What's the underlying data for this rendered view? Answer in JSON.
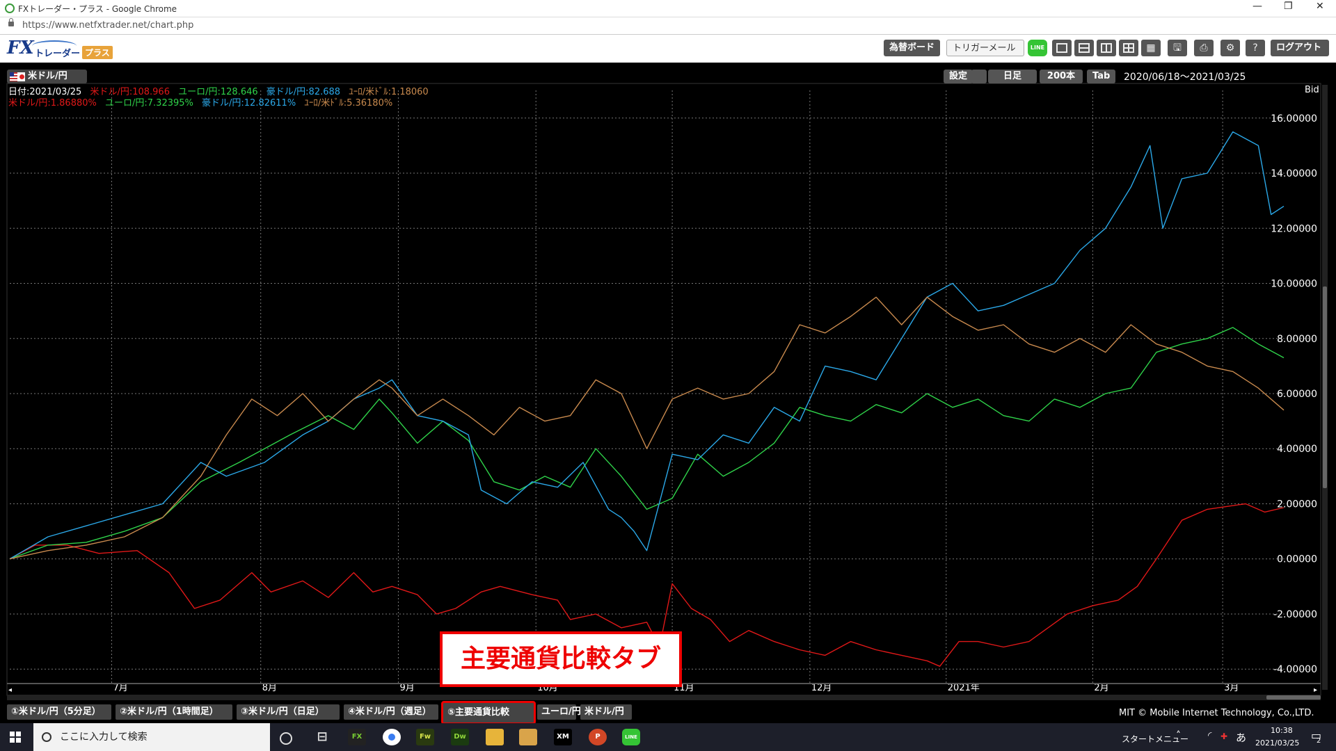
{
  "browser": {
    "title": "FXトレーダー・プラス - Google Chrome",
    "url": "https://www.netfxtrader.net/chart.php"
  },
  "app": {
    "logo_fx": "FX",
    "logo_trader": "トレーダー・",
    "logo_plus": "プラス",
    "buttons": {
      "rate_board": "為替ボード",
      "trigger_mail": "トリガーメール",
      "line": "LINE",
      "logout": "ログアウト"
    }
  },
  "chart_panel": {
    "pair_label": "米ドル/円",
    "settings": "設定",
    "timeframe": "日足",
    "bars": "200本",
    "tab_btn": "Tab",
    "range": "2020/06/18～2021/03/25",
    "price_type": "Bid"
  },
  "info_line1": {
    "date": "日付:2021/03/25",
    "usdjpy": "米ドル/円:108.966",
    "eurjpy": "ユーロ/円:128.646",
    "audjpy": "豪ドル/円:82.688",
    "eurusd": "ﾕｰﾛ/米ﾄﾞﾙ:1.18060"
  },
  "info_line2": {
    "usdjpy": "米ドル/円:1.86880%",
    "eurjpy": "ユーロ/円:7.32395%",
    "audjpy": "豪ドル/円:12.82611%",
    "eurusd": "ﾕｰﾛ/米ﾄﾞﾙ:5.36180%"
  },
  "colors": {
    "usdjpy": "#e01818",
    "eurjpy": "#2fd34a",
    "audjpy": "#2ba8e8",
    "eurusd": "#c98a4e"
  },
  "chart_data": {
    "type": "line",
    "ylim": [
      -4.5,
      16.5
    ],
    "y_ticks": [
      "16.00000",
      "14.00000",
      "12.00000",
      "10.00000",
      "8.00000",
      "6.00000",
      "4.00000",
      "2.00000",
      "0.00000",
      "-2.00000",
      "-4.00000"
    ],
    "x_labels": [
      "7月",
      "8月",
      "9月",
      "10月",
      "11月",
      "12月",
      "2021年",
      "2月",
      "3月"
    ],
    "x_label_positions": [
      0.08,
      0.197,
      0.305,
      0.413,
      0.52,
      0.628,
      0.735,
      0.85,
      0.952
    ],
    "x_range": [
      0,
      1
    ],
    "series": [
      {
        "name": "米ドル/円",
        "key": "usdjpy",
        "x": [
          0,
          0.02,
          0.045,
          0.07,
          0.1,
          0.125,
          0.145,
          0.165,
          0.19,
          0.205,
          0.23,
          0.25,
          0.27,
          0.285,
          0.3,
          0.32,
          0.335,
          0.35,
          0.37,
          0.385,
          0.41,
          0.43,
          0.44,
          0.46,
          0.48,
          0.5,
          0.51,
          0.52,
          0.535,
          0.55,
          0.565,
          0.58,
          0.6,
          0.62,
          0.64,
          0.66,
          0.68,
          0.7,
          0.72,
          0.73,
          0.745,
          0.76,
          0.78,
          0.8,
          0.83,
          0.85,
          0.87,
          0.885,
          0.9,
          0.92,
          0.94,
          0.955,
          0.97,
          0.985,
          1.0
        ],
        "y": [
          0,
          0.5,
          0.5,
          0.2,
          0.3,
          -0.5,
          -1.8,
          -1.5,
          -0.5,
          -1.2,
          -0.8,
          -1.4,
          -0.5,
          -1.2,
          -1.0,
          -1.3,
          -2.0,
          -1.8,
          -1.2,
          -1.0,
          -1.3,
          -1.5,
          -2.2,
          -2.0,
          -2.5,
          -2.3,
          -3.2,
          -0.9,
          -1.8,
          -2.2,
          -3.0,
          -2.6,
          -3.0,
          -3.3,
          -3.5,
          -3.0,
          -3.3,
          -3.5,
          -3.7,
          -3.9,
          -3.0,
          -3.0,
          -3.2,
          -3.0,
          -2.0,
          -1.7,
          -1.5,
          -1.0,
          0.0,
          1.4,
          1.8,
          1.9,
          2.0,
          1.7,
          1.86
        ]
      },
      {
        "name": "ユーロ/円",
        "key": "eurjpy",
        "x": [
          0,
          0.03,
          0.06,
          0.09,
          0.12,
          0.15,
          0.18,
          0.2,
          0.22,
          0.25,
          0.27,
          0.29,
          0.3,
          0.32,
          0.34,
          0.36,
          0.38,
          0.4,
          0.42,
          0.44,
          0.46,
          0.48,
          0.5,
          0.52,
          0.54,
          0.56,
          0.58,
          0.6,
          0.62,
          0.64,
          0.66,
          0.68,
          0.7,
          0.72,
          0.74,
          0.76,
          0.78,
          0.8,
          0.82,
          0.84,
          0.86,
          0.88,
          0.9,
          0.92,
          0.94,
          0.96,
          0.98,
          1.0
        ],
        "y": [
          0,
          0.5,
          0.6,
          1.0,
          1.5,
          2.8,
          3.5,
          4.0,
          4.5,
          5.2,
          4.7,
          5.8,
          5.3,
          4.2,
          5.0,
          4.3,
          2.8,
          2.5,
          3.0,
          2.6,
          4.0,
          3.0,
          1.8,
          2.2,
          3.8,
          3.0,
          3.5,
          4.2,
          5.5,
          5.2,
          5.0,
          5.6,
          5.3,
          6.0,
          5.5,
          5.8,
          5.2,
          5.0,
          5.8,
          5.5,
          6.0,
          6.2,
          7.5,
          7.8,
          8.0,
          8.4,
          7.8,
          7.3
        ]
      },
      {
        "name": "豪ドル/円",
        "key": "audjpy",
        "x": [
          0,
          0.03,
          0.06,
          0.09,
          0.12,
          0.15,
          0.17,
          0.2,
          0.23,
          0.25,
          0.27,
          0.29,
          0.3,
          0.32,
          0.34,
          0.36,
          0.37,
          0.39,
          0.41,
          0.43,
          0.45,
          0.47,
          0.48,
          0.49,
          0.5,
          0.52,
          0.54,
          0.56,
          0.58,
          0.6,
          0.62,
          0.64,
          0.66,
          0.68,
          0.7,
          0.72,
          0.74,
          0.76,
          0.78,
          0.8,
          0.82,
          0.84,
          0.86,
          0.88,
          0.895,
          0.905,
          0.92,
          0.94,
          0.96,
          0.98,
          0.99,
          1.0
        ],
        "y": [
          0,
          0.8,
          1.2,
          1.6,
          2.0,
          3.5,
          3.0,
          3.5,
          4.5,
          5.0,
          5.8,
          6.2,
          6.5,
          5.2,
          5.0,
          4.5,
          2.5,
          2.0,
          2.8,
          2.6,
          3.5,
          1.8,
          1.5,
          1.0,
          0.3,
          3.8,
          3.6,
          4.5,
          4.2,
          5.5,
          5.0,
          7.0,
          6.8,
          6.5,
          8.0,
          9.5,
          10.0,
          9.0,
          9.2,
          9.6,
          10.0,
          11.2,
          12.0,
          13.5,
          15.0,
          12.0,
          13.8,
          14.0,
          15.5,
          15.0,
          12.5,
          12.8
        ]
      },
      {
        "name": "ﾕｰﾛ/米ﾄﾞﾙ",
        "key": "eurusd",
        "x": [
          0,
          0.03,
          0.06,
          0.09,
          0.12,
          0.15,
          0.17,
          0.19,
          0.21,
          0.23,
          0.25,
          0.27,
          0.29,
          0.3,
          0.32,
          0.34,
          0.36,
          0.38,
          0.4,
          0.42,
          0.44,
          0.46,
          0.48,
          0.5,
          0.52,
          0.54,
          0.56,
          0.58,
          0.6,
          0.62,
          0.64,
          0.66,
          0.68,
          0.7,
          0.72,
          0.74,
          0.76,
          0.78,
          0.8,
          0.82,
          0.84,
          0.86,
          0.88,
          0.9,
          0.92,
          0.94,
          0.96,
          0.98,
          1.0
        ],
        "y": [
          0,
          0.3,
          0.5,
          0.8,
          1.5,
          3.0,
          4.5,
          5.8,
          5.2,
          6.0,
          5.0,
          5.8,
          6.5,
          6.2,
          5.2,
          5.8,
          5.2,
          4.5,
          5.5,
          5.0,
          5.2,
          6.5,
          6.0,
          4.0,
          5.8,
          6.2,
          5.8,
          6.0,
          6.8,
          8.5,
          8.2,
          8.8,
          9.5,
          8.5,
          9.5,
          8.8,
          8.3,
          8.5,
          7.8,
          7.5,
          8.0,
          7.5,
          8.5,
          7.8,
          7.5,
          7.0,
          6.8,
          6.2,
          5.4
        ]
      }
    ]
  },
  "bottom_tabs": [
    "①米ドル/円（5分足）",
    "②米ドル/円（1時間足）",
    "③米ドル/円（日足）",
    "④米ドル/円（週足）",
    "⑤主要通貨比較",
    "ユーロ/円",
    "米ドル/円"
  ],
  "copyright": "MIT © Mobile Internet Technology, Co.,LTD.",
  "annotation": "主要通貨比較タブ",
  "taskbar": {
    "search_placeholder": "ここに入力して検索",
    "start_menu": "スタートメニュー",
    "ime": "あ",
    "time": "10:38",
    "date": "2021/03/25",
    "notifications": "2"
  }
}
